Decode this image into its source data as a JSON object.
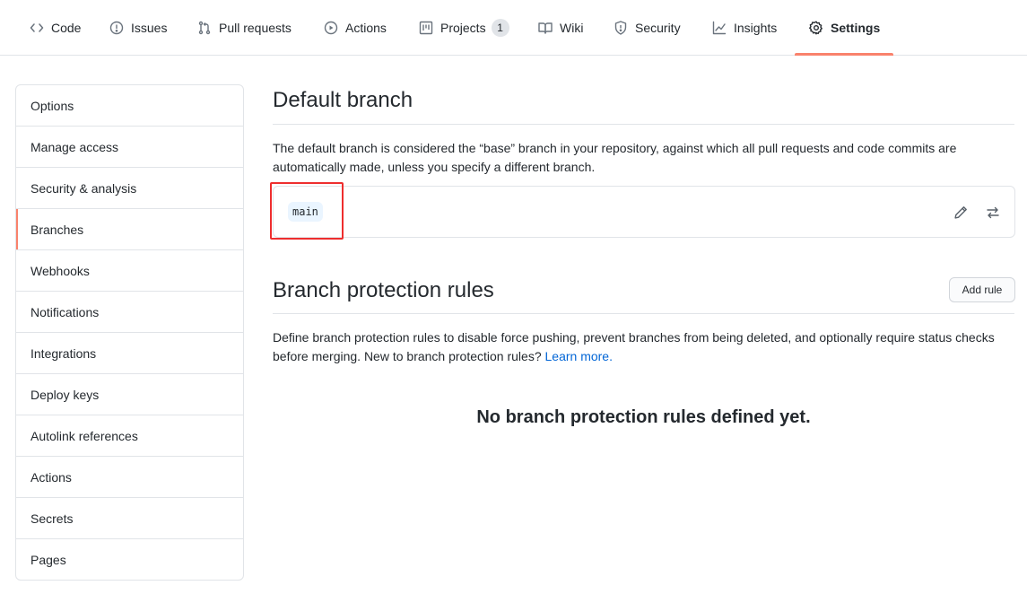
{
  "nav": {
    "tabs": [
      {
        "label": "Code",
        "icon": "code-icon"
      },
      {
        "label": "Issues",
        "icon": "issue-icon"
      },
      {
        "label": "Pull requests",
        "icon": "pull-request-icon"
      },
      {
        "label": "Actions",
        "icon": "play-icon"
      },
      {
        "label": "Projects",
        "icon": "project-icon",
        "counter": "1"
      },
      {
        "label": "Wiki",
        "icon": "book-icon"
      },
      {
        "label": "Security",
        "icon": "shield-icon"
      },
      {
        "label": "Insights",
        "icon": "graph-icon"
      },
      {
        "label": "Settings",
        "icon": "gear-icon",
        "active": true
      }
    ],
    "accent_color": "#f9826c"
  },
  "sidebar": {
    "items": [
      {
        "label": "Options"
      },
      {
        "label": "Manage access"
      },
      {
        "label": "Security & analysis"
      },
      {
        "label": "Branches",
        "active": true
      },
      {
        "label": "Webhooks"
      },
      {
        "label": "Notifications"
      },
      {
        "label": "Integrations"
      },
      {
        "label": "Deploy keys"
      },
      {
        "label": "Autolink references"
      },
      {
        "label": "Actions"
      },
      {
        "label": "Secrets"
      },
      {
        "label": "Pages"
      }
    ]
  },
  "default_branch": {
    "title": "Default branch",
    "description": "The default branch is considered the “base” branch in your repository, against which all pull requests and code commits are automatically made, unless you specify a different branch.",
    "branch_name": "main",
    "edit_icon": "pencil-icon",
    "switch_icon": "arrow-switch-icon",
    "highlight_color": "#ee2e2e"
  },
  "protection": {
    "title": "Branch protection rules",
    "add_rule_label": "Add rule",
    "description": "Define branch protection rules to disable force pushing, prevent branches from being deleted, and optionally require status checks before merging. New to branch protection rules?",
    "learn_more": "Learn more.",
    "empty_state": "No branch protection rules defined yet.",
    "link_color": "#0366d6"
  }
}
